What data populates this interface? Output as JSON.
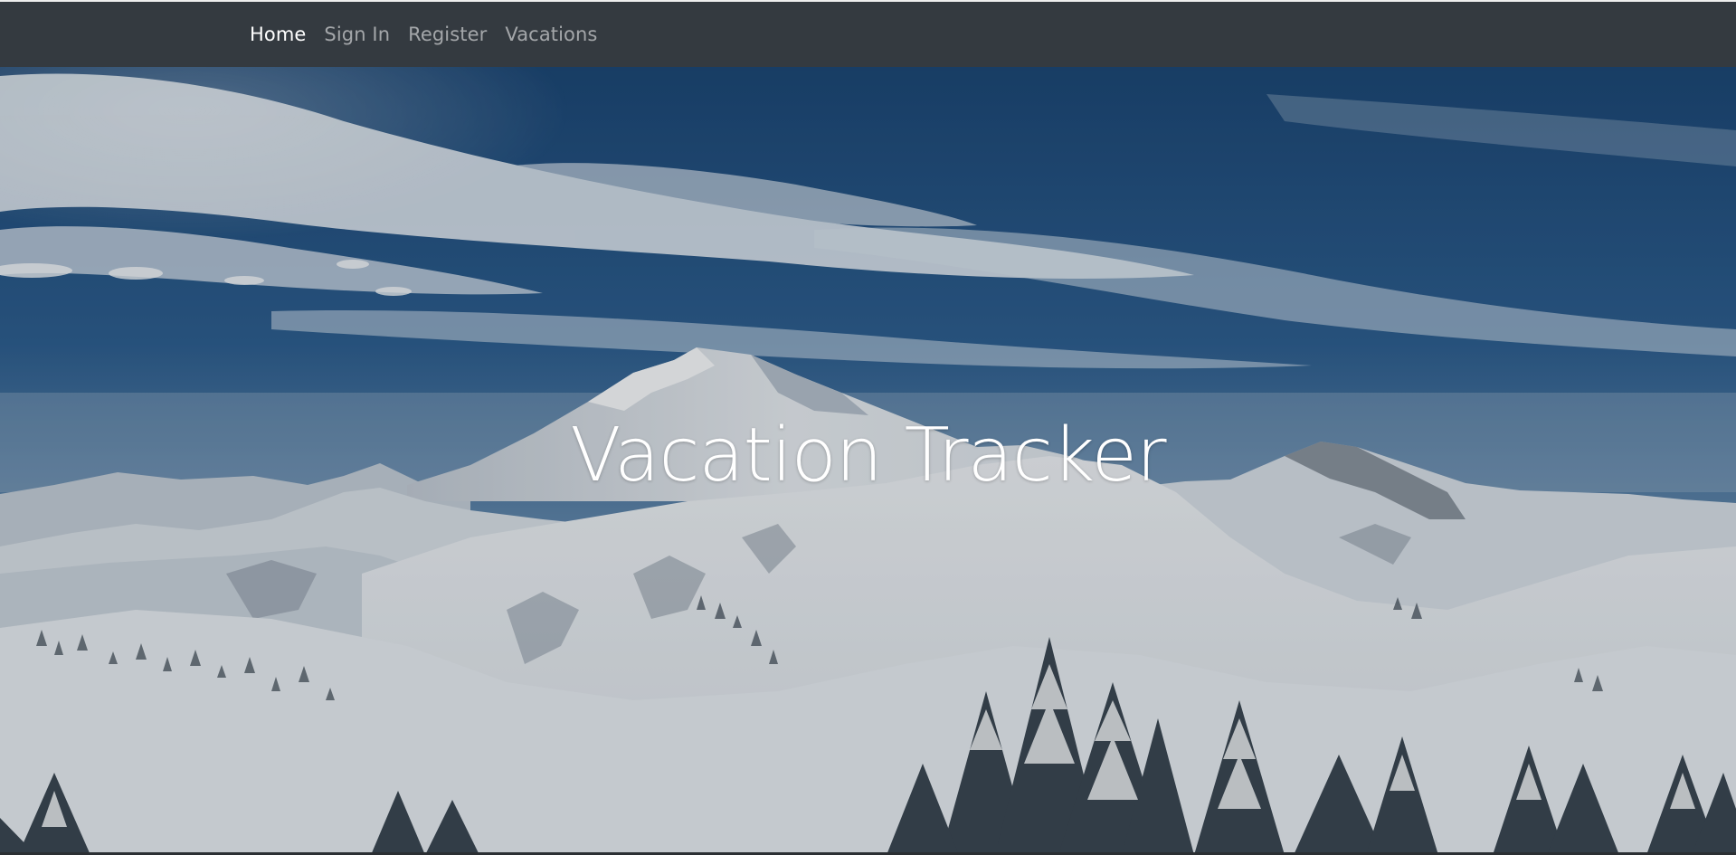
{
  "nav": {
    "items": [
      {
        "label": "Home",
        "active": true
      },
      {
        "label": "Sign In",
        "active": false
      },
      {
        "label": "Register",
        "active": false
      },
      {
        "label": "Vacations",
        "active": false
      }
    ]
  },
  "hero": {
    "title": "Vacation Tracker",
    "background": "snowy-mountain-landscape"
  },
  "colors": {
    "navbar": "#343a40",
    "nav_active": "#ffffff",
    "nav_inactive": "#a7a9ab",
    "sky_top": "#1c4a78",
    "sky_bottom": "#6f93b4",
    "snow": "#e9edf0"
  }
}
